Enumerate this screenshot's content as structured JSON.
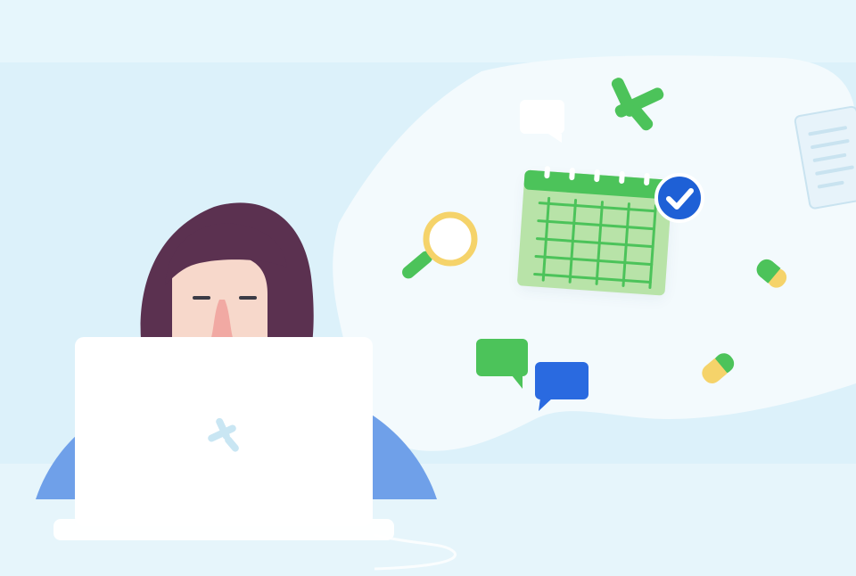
{
  "palette": {
    "background": "#DCF1FA",
    "background_light": "#E9F7FC",
    "floor": "#E6F5FB",
    "cloud": "#F3FAFD",
    "laptop": "#FFFFFF",
    "laptop_logo": "#C9E6F3",
    "hair": "#5B3150",
    "skin": "#F7D8CB",
    "nose": "#F1A9A3",
    "shirt": "#6FA0E9",
    "brand_green": "#4CC35A",
    "calendar_fill": "#B8E3A8",
    "calendar_line": "#4CC35A",
    "check_badge": "#1E60D6",
    "magnifier_ring": "#F5D36A",
    "pill_yellow": "#F5D36A",
    "chat_green": "#4CC35A",
    "chat_blue": "#2A6AE0",
    "document": "#E7F3FA"
  },
  "icons": [
    "brand-logo-icon",
    "calendar-icon",
    "check-badge-icon",
    "magnifier-icon",
    "chat-bubble-icon",
    "pill-icon",
    "document-icon",
    "laptop-logo-icon"
  ]
}
